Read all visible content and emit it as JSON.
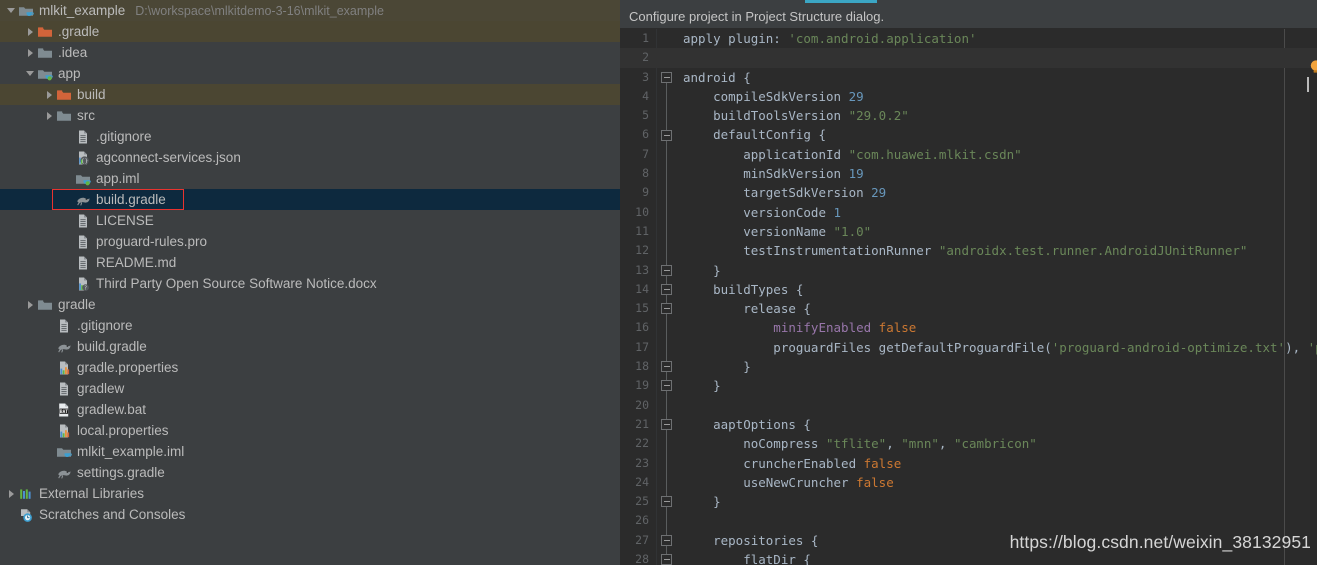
{
  "sidebar": {
    "rows": [
      {
        "label": "mlkit_example",
        "path": "D:\\workspace\\mlkitdemo-3-16\\mlkit_example",
        "indent": 0,
        "twisty": "expanded",
        "icon": "module-icon",
        "state": "root"
      },
      {
        "label": ".gradle",
        "indent": 1,
        "twisty": "collapsed",
        "icon": "folder-orange-icon",
        "state": "excluded"
      },
      {
        "label": ".idea",
        "indent": 1,
        "twisty": "collapsed",
        "icon": "folder-icon",
        "state": "normal"
      },
      {
        "label": "app",
        "indent": 1,
        "twisty": "expanded",
        "icon": "module-green-icon",
        "state": "normal"
      },
      {
        "label": "build",
        "indent": 2,
        "twisty": "collapsed",
        "icon": "folder-orange-icon",
        "state": "excluded"
      },
      {
        "label": "src",
        "indent": 2,
        "twisty": "collapsed",
        "icon": "folder-icon",
        "state": "normal"
      },
      {
        "label": ".gitignore",
        "indent": 3,
        "twisty": "none",
        "icon": "file-text-icon",
        "state": "normal"
      },
      {
        "label": "agconnect-services.json",
        "indent": 3,
        "twisty": "none",
        "icon": "json-icon",
        "state": "normal"
      },
      {
        "label": "app.iml",
        "indent": 3,
        "twisty": "none",
        "icon": "module-green-icon",
        "state": "normal"
      },
      {
        "label": "build.gradle",
        "indent": 3,
        "twisty": "none",
        "icon": "gradle-icon",
        "state": "selected"
      },
      {
        "label": "LICENSE",
        "indent": 3,
        "twisty": "none",
        "icon": "file-text-icon",
        "state": "normal"
      },
      {
        "label": "proguard-rules.pro",
        "indent": 3,
        "twisty": "none",
        "icon": "file-text-icon",
        "state": "normal"
      },
      {
        "label": "README.md",
        "indent": 3,
        "twisty": "none",
        "icon": "file-text-icon",
        "state": "normal"
      },
      {
        "label": "Third Party Open Source Software Notice.docx",
        "indent": 3,
        "twisty": "none",
        "icon": "docx-icon",
        "state": "normal"
      },
      {
        "label": "gradle",
        "indent": 1,
        "twisty": "collapsed",
        "icon": "folder-icon",
        "state": "normal"
      },
      {
        "label": ".gitignore",
        "indent": 2,
        "twisty": "none",
        "icon": "file-text-icon",
        "state": "normal"
      },
      {
        "label": "build.gradle",
        "indent": 2,
        "twisty": "none",
        "icon": "gradle-icon",
        "state": "normal"
      },
      {
        "label": "gradle.properties",
        "indent": 2,
        "twisty": "none",
        "icon": "properties-icon",
        "state": "normal"
      },
      {
        "label": "gradlew",
        "indent": 2,
        "twisty": "none",
        "icon": "file-text-icon",
        "state": "normal"
      },
      {
        "label": "gradlew.bat",
        "indent": 2,
        "twisty": "none",
        "icon": "bat-icon",
        "state": "normal"
      },
      {
        "label": "local.properties",
        "indent": 2,
        "twisty": "none",
        "icon": "properties-icon",
        "state": "normal"
      },
      {
        "label": "mlkit_example.iml",
        "indent": 2,
        "twisty": "none",
        "icon": "module-icon",
        "state": "normal"
      },
      {
        "label": "settings.gradle",
        "indent": 2,
        "twisty": "none",
        "icon": "gradle-icon",
        "state": "normal"
      },
      {
        "label": "External Libraries",
        "indent": 0,
        "twisty": "collapsed",
        "icon": "libraries-icon",
        "state": "normal"
      },
      {
        "label": "Scratches and Consoles",
        "indent": 0,
        "twisty": "none",
        "icon": "scratches-icon",
        "state": "normal"
      }
    ]
  },
  "editor": {
    "notification": "Configure project in Project Structure dialog.",
    "watermark": "https://blog.csdn.net/weixin_38132951",
    "caret_line": 2,
    "lines": [
      {
        "n": "1",
        "tokens": [
          {
            "t": "apply plugin: ",
            "c": "ident"
          },
          {
            "t": "'com.android.application'",
            "c": "str"
          }
        ]
      },
      {
        "n": "2",
        "tokens": []
      },
      {
        "n": "3",
        "fold": "open",
        "tokens": [
          {
            "t": "android {",
            "c": "ident"
          }
        ]
      },
      {
        "n": "4",
        "tokens": [
          {
            "t": "    compileSdkVersion ",
            "c": "ident"
          },
          {
            "t": "29",
            "c": "num"
          }
        ]
      },
      {
        "n": "5",
        "tokens": [
          {
            "t": "    buildToolsVersion ",
            "c": "ident"
          },
          {
            "t": "\"29.0.2\"",
            "c": "str"
          }
        ]
      },
      {
        "n": "6",
        "fold": "open",
        "tokens": [
          {
            "t": "    defaultConfig {",
            "c": "ident"
          }
        ]
      },
      {
        "n": "7",
        "tokens": [
          {
            "t": "        applicationId ",
            "c": "ident"
          },
          {
            "t": "\"com.huawei.mlkit.csdn\"",
            "c": "str"
          }
        ]
      },
      {
        "n": "8",
        "tokens": [
          {
            "t": "        minSdkVersion ",
            "c": "ident"
          },
          {
            "t": "19",
            "c": "num"
          }
        ]
      },
      {
        "n": "9",
        "tokens": [
          {
            "t": "        targetSdkVersion ",
            "c": "ident"
          },
          {
            "t": "29",
            "c": "num"
          }
        ]
      },
      {
        "n": "10",
        "tokens": [
          {
            "t": "        versionCode ",
            "c": "ident"
          },
          {
            "t": "1",
            "c": "num"
          }
        ]
      },
      {
        "n": "11",
        "tokens": [
          {
            "t": "        versionName ",
            "c": "ident"
          },
          {
            "t": "\"1.0\"",
            "c": "str"
          }
        ]
      },
      {
        "n": "12",
        "tokens": [
          {
            "t": "        testInstrumentationRunner ",
            "c": "ident"
          },
          {
            "t": "\"androidx.test.runner.AndroidJUnitRunner\"",
            "c": "str"
          }
        ]
      },
      {
        "n": "13",
        "fold": "close",
        "tokens": [
          {
            "t": "    }",
            "c": "ident"
          }
        ]
      },
      {
        "n": "14",
        "fold": "open",
        "tokens": [
          {
            "t": "    buildTypes {",
            "c": "ident"
          }
        ]
      },
      {
        "n": "15",
        "fold": "open",
        "tokens": [
          {
            "t": "        release {",
            "c": "ident"
          }
        ]
      },
      {
        "n": "16",
        "tokens": [
          {
            "t": "            minifyEnabled ",
            "c": "prop"
          },
          {
            "t": "false",
            "c": "kw"
          }
        ]
      },
      {
        "n": "17",
        "tokens": [
          {
            "t": "            proguardFiles getDefaultProguardFile(",
            "c": "ident"
          },
          {
            "t": "'proguard-android-optimize.txt'",
            "c": "str"
          },
          {
            "t": "), ",
            "c": "ident"
          },
          {
            "t": "'proguard-rules.pro'",
            "c": "str"
          }
        ]
      },
      {
        "n": "18",
        "fold": "close",
        "tokens": [
          {
            "t": "        }",
            "c": "ident"
          }
        ]
      },
      {
        "n": "19",
        "fold": "close",
        "tokens": [
          {
            "t": "    }",
            "c": "ident"
          }
        ]
      },
      {
        "n": "20",
        "tokens": []
      },
      {
        "n": "21",
        "fold": "open",
        "tokens": [
          {
            "t": "    aaptOptions {",
            "c": "ident"
          }
        ]
      },
      {
        "n": "22",
        "tokens": [
          {
            "t": "        noCompress ",
            "c": "ident"
          },
          {
            "t": "\"tflite\"",
            "c": "str"
          },
          {
            "t": ", ",
            "c": "ident"
          },
          {
            "t": "\"mnn\"",
            "c": "str"
          },
          {
            "t": ", ",
            "c": "ident"
          },
          {
            "t": "\"cambricon\"",
            "c": "str"
          }
        ]
      },
      {
        "n": "23",
        "tokens": [
          {
            "t": "        cruncherEnabled ",
            "c": "ident"
          },
          {
            "t": "false",
            "c": "kw"
          }
        ]
      },
      {
        "n": "24",
        "tokens": [
          {
            "t": "        useNewCruncher ",
            "c": "ident"
          },
          {
            "t": "false",
            "c": "kw"
          }
        ]
      },
      {
        "n": "25",
        "fold": "close",
        "tokens": [
          {
            "t": "    }",
            "c": "ident"
          }
        ]
      },
      {
        "n": "26",
        "tokens": []
      },
      {
        "n": "27",
        "fold": "open",
        "tokens": [
          {
            "t": "    repositories {",
            "c": "ident"
          }
        ]
      },
      {
        "n": "28",
        "fold": "open",
        "tokens": [
          {
            "t": "        flatDir {",
            "c": "ident"
          }
        ]
      }
    ]
  },
  "colors": {
    "annotation_red": "#e8332f",
    "tab_accent": "#3ba6c4",
    "selection_blue": "#0d293e",
    "excluded_olive": "#4b4632"
  }
}
